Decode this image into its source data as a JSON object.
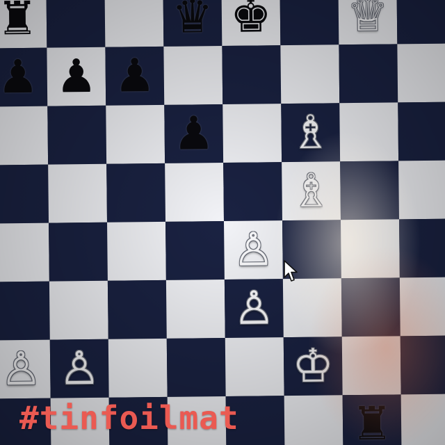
{
  "board": {
    "files": [
      "a",
      "b",
      "c",
      "d",
      "e",
      "f",
      "g",
      "h"
    ],
    "ranks": [
      "8",
      "7",
      "6",
      "5",
      "4",
      "3",
      "2",
      "1"
    ],
    "light_color": "#f2f3f7",
    "dark_color": "#1a2242",
    "top_left_square": "light",
    "pieces": [
      {
        "square": "a8",
        "type": "rook",
        "color": "black",
        "glyph": "♜"
      },
      {
        "square": "d8",
        "type": "queen",
        "color": "black",
        "glyph": "♛"
      },
      {
        "square": "e8",
        "type": "king",
        "color": "black",
        "glyph": "♚"
      },
      {
        "square": "g8",
        "type": "queen",
        "color": "white",
        "glyph": "♕"
      },
      {
        "square": "a7",
        "type": "pawn",
        "color": "black",
        "glyph": "♟"
      },
      {
        "square": "b7",
        "type": "pawn",
        "color": "black",
        "glyph": "♟"
      },
      {
        "square": "c7",
        "type": "pawn",
        "color": "black",
        "glyph": "♟"
      },
      {
        "square": "d6",
        "type": "pawn",
        "color": "black",
        "glyph": "♟"
      },
      {
        "square": "f6",
        "type": "bishop",
        "color": "white",
        "glyph": "♗"
      },
      {
        "square": "f5",
        "type": "bishop",
        "color": "white",
        "glyph": "♗"
      },
      {
        "square": "e4",
        "type": "pawn",
        "color": "white",
        "glyph": "♙"
      },
      {
        "square": "e3",
        "type": "pawn",
        "color": "white",
        "glyph": "♙"
      },
      {
        "square": "a2",
        "type": "pawn",
        "color": "white",
        "glyph": "♙"
      },
      {
        "square": "b2",
        "type": "pawn",
        "color": "white",
        "glyph": "♙"
      },
      {
        "square": "f2",
        "type": "king",
        "color": "white",
        "glyph": "♔"
      },
      {
        "square": "g1",
        "type": "rook",
        "color": "black",
        "glyph": "♜"
      }
    ]
  },
  "cursor": {
    "icon": "mouse-pointer-icon",
    "hover_square": "e4"
  },
  "overlay": {
    "hashtag": "#tinfoilmat",
    "hashtag_color": "#ea5a52"
  }
}
